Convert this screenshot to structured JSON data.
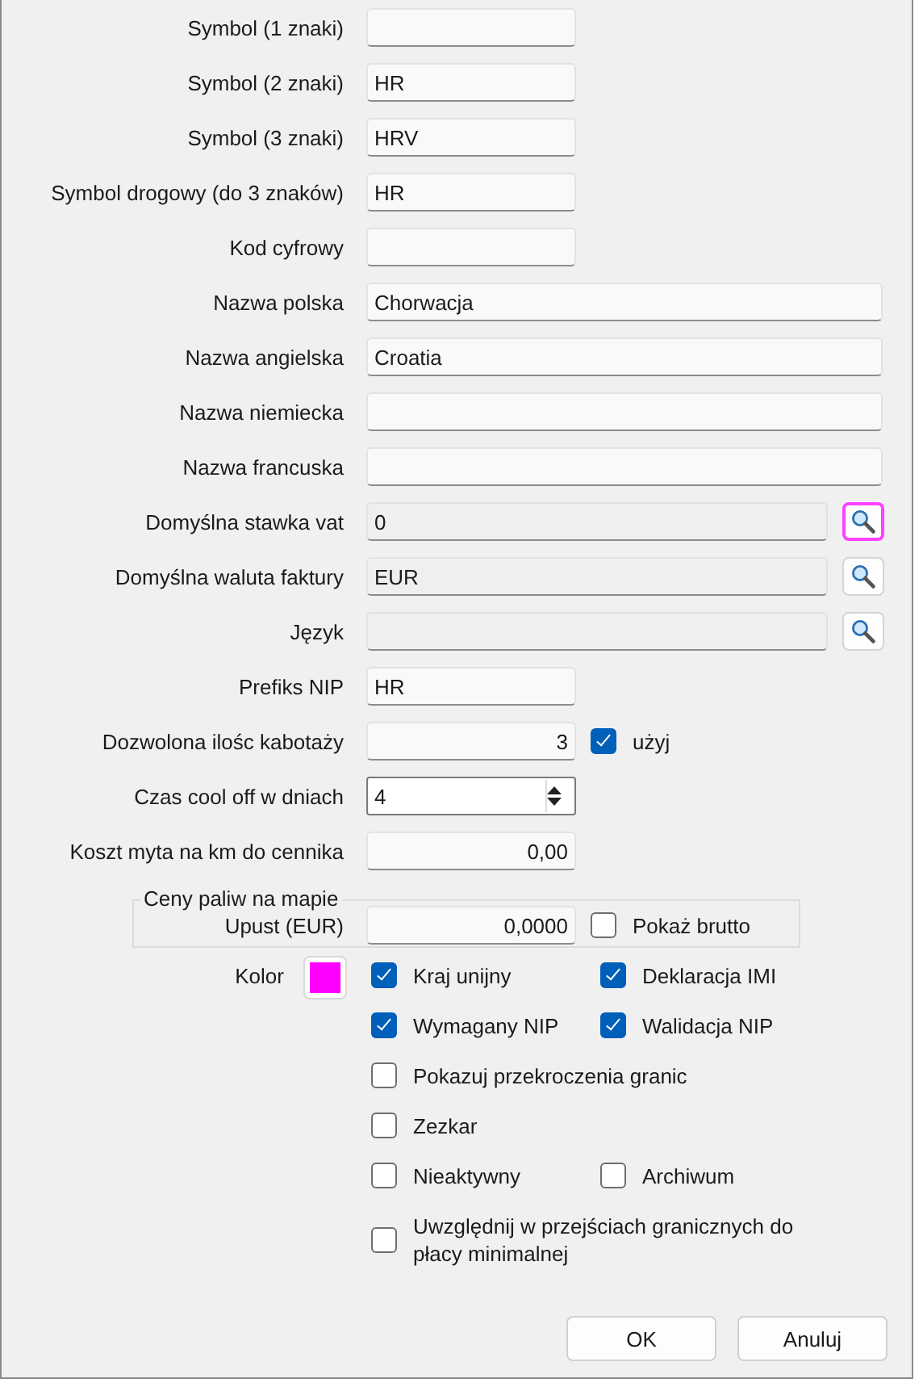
{
  "fields": [
    {
      "kind": "short",
      "label": "Symbol (1 znaki)"
    },
    {
      "kind": "short",
      "label": "Symbol (2 znaki)",
      "value": "HR"
    },
    {
      "kind": "short",
      "label": "Symbol (3 znaki)",
      "value": "HRV"
    },
    {
      "kind": "short",
      "label": "Symbol drogowy (do 3 znaków)",
      "value": "HR"
    },
    {
      "kind": "short",
      "label": "Kod cyfrowy"
    },
    {
      "kind": "long",
      "label": "Nazwa polska",
      "value": "Chorwacja"
    },
    {
      "kind": "long",
      "label": "Nazwa angielska",
      "value": "Croatia"
    },
    {
      "kind": "long",
      "label": "Nazwa niemiecka"
    },
    {
      "kind": "long",
      "label": "Nazwa francuska"
    },
    {
      "kind": "lookup",
      "label": "Domyślna stawka vat",
      "value": "0",
      "button_focused": true
    },
    {
      "kind": "lookup",
      "label": "Domyślna waluta faktury",
      "value": "EUR",
      "button_focused": false
    },
    {
      "kind": "lookup",
      "label": "Język",
      "button_focused": false
    },
    {
      "kind": "short",
      "label": "Prefiks NIP",
      "value": "HR"
    },
    {
      "kind": "number",
      "label": "Dozwolona ilośc kabotaży",
      "value": "3",
      "checkbox": {
        "label": "użyj",
        "checked": true
      }
    },
    {
      "kind": "spin",
      "label": "Czas cool off w dniach",
      "value": "4"
    },
    {
      "kind": "number",
      "label": "Koszt myta na km do cennika",
      "value": "0,00"
    }
  ],
  "fuel_prices": {
    "title": "Ceny paliw na mapie",
    "label": "Upust (EUR)",
    "value": "0,0000",
    "checkbox": {
      "label": "Pokaż brutto",
      "checked": false
    }
  },
  "color": {
    "label": "Kolor",
    "color": "#ff00ff"
  },
  "options": [
    [
      {
        "label": "Kraj unijny",
        "checked": true
      },
      {
        "label": "Deklaracja IMI",
        "checked": true
      }
    ],
    [
      {
        "label": "Wymagany NIP",
        "checked": true
      },
      {
        "label": "Walidacja NIP",
        "checked": true
      }
    ],
    [
      {
        "label": "Pokazuj przekroczenia granic",
        "checked": false
      }
    ],
    [
      {
        "label": "Zezkar",
        "checked": false
      }
    ],
    [
      {
        "label": "Nieaktywny",
        "checked": false
      },
      {
        "label": "Archiwum",
        "checked": false
      }
    ],
    [
      {
        "label": "Uwzględnij w przejściach granicznych do płacy minimalnej",
        "checked": false
      }
    ]
  ],
  "buttons": [
    "OK",
    "Anuluj"
  ]
}
